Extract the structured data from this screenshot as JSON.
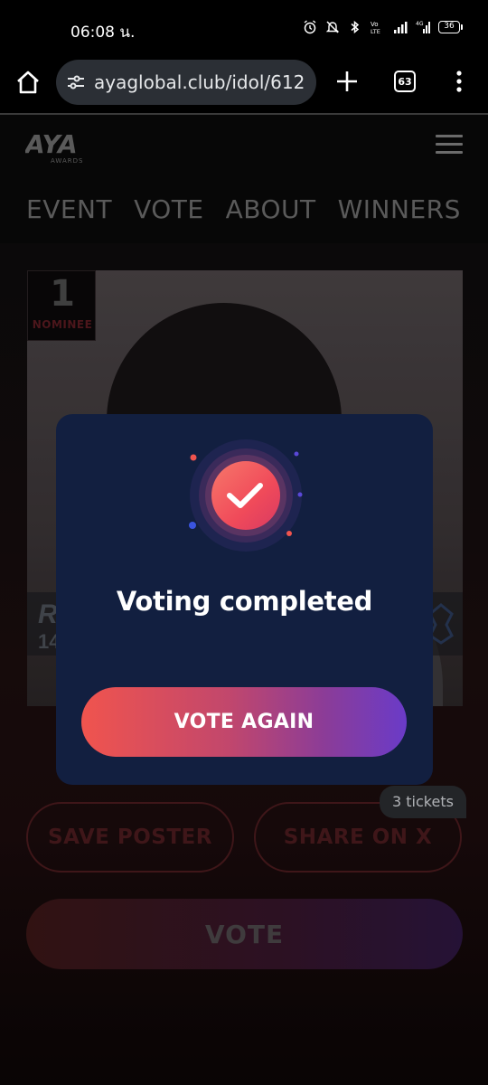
{
  "status_bar": {
    "time": "06:08 น.",
    "battery": "36",
    "icons": [
      "alarm-icon",
      "mute-icon",
      "bluetooth-icon",
      "volte-icon",
      "signal-icon",
      "4g-signal-icon",
      "battery-icon"
    ]
  },
  "browser": {
    "url": "ayaglobal.club/idol/612",
    "tab_count": "63",
    "icons": [
      "home-icon",
      "site-settings-icon",
      "new-tab-icon",
      "tabs-icon",
      "more-menu-icon"
    ]
  },
  "site": {
    "logo_text": "AYA",
    "logo_subtext": "AWARDS",
    "nav": [
      "EVENT",
      "VOTE",
      "ABOUT",
      "WINNERS"
    ]
  },
  "candidate": {
    "rank": "1",
    "rank_label": "NOMINEE",
    "name_initial": "R",
    "count_prefix": "14"
  },
  "actions": {
    "tickets": "3 tickets",
    "save_poster": "SAVE  POSTER",
    "share_on_x": "SHARE ON X",
    "vote": "VOTE"
  },
  "modal": {
    "title": "Voting completed",
    "button": "VOTE AGAIN"
  },
  "colors": {
    "modal_bg": "#121f40",
    "accent_start": "#f0544e",
    "accent_end": "#6a3bc8"
  }
}
